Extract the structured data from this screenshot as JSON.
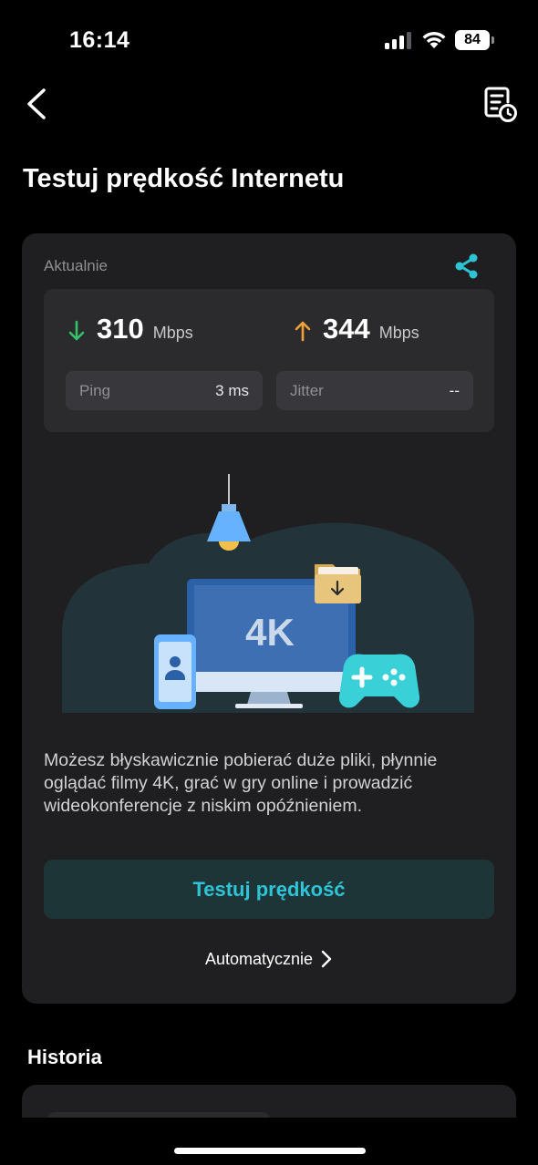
{
  "status_bar": {
    "time": "16:14",
    "battery": "84"
  },
  "header": {
    "back_icon": "chevron-left-icon",
    "history_icon": "report-clock-icon"
  },
  "page": {
    "title": "Testuj prędkość Internetu"
  },
  "card": {
    "label": "Aktualnie",
    "share_icon": "share-icon",
    "download": {
      "value": "310",
      "unit": "Mbps",
      "color": "#33c26b"
    },
    "upload": {
      "value": "344",
      "unit": "Mbps",
      "color": "#f0a23a"
    },
    "ping": {
      "label": "Ping",
      "value": "3 ms"
    },
    "jitter": {
      "label": "Jitter",
      "value": "--"
    },
    "illustration": {
      "screen_text": "4K"
    },
    "description": "Możesz błyskawicznie pobierać duże pliki, płynnie oglądać filmy 4K, grać w gry online i prowadzić wideokonferencje z niskim opóźnieniem.",
    "test_button": "Testuj prędkość",
    "auto_link": "Automatycznie"
  },
  "history": {
    "title": "Historia"
  },
  "colors": {
    "accent": "#2ec4d6",
    "card_bg": "#1f1f21",
    "results_bg": "#2b2b2e"
  }
}
